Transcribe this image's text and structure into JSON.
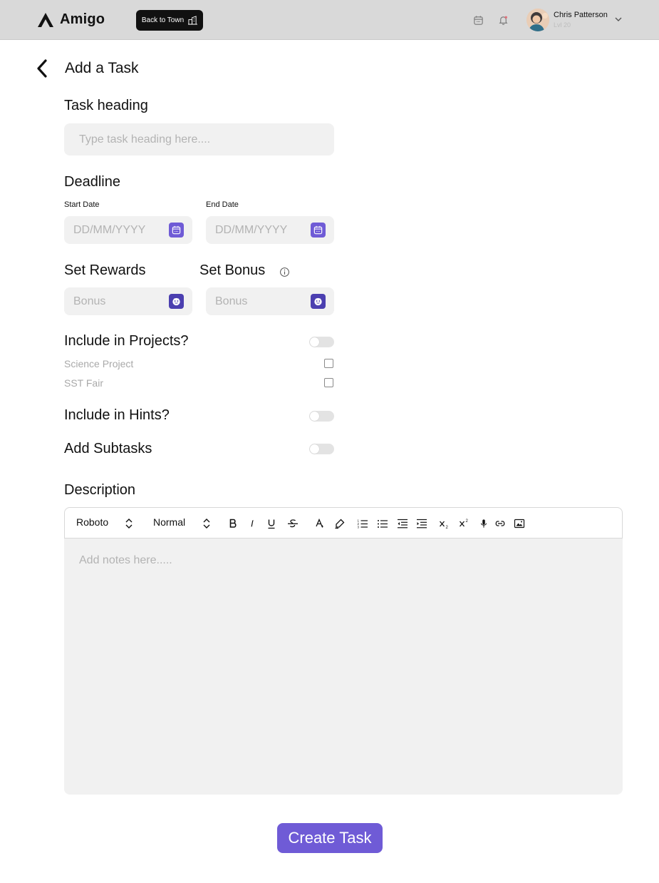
{
  "topbar": {
    "logo_text": "Amigo",
    "back_to_town_label": "Back to Town",
    "user": {
      "name": "Chris Patterson",
      "level": "Lvl 20"
    }
  },
  "page": {
    "title": "Add a Task"
  },
  "task_heading": {
    "title": "Task heading",
    "placeholder": "Type task heading here...."
  },
  "deadline": {
    "title": "Deadline",
    "start_label": "Start Date",
    "start_placeholder": "DD/MM/YYYY",
    "end_label": "End Date",
    "end_placeholder": "DD/MM/YYYY"
  },
  "rewards": {
    "title": "Set Rewards",
    "placeholder": "Bonus"
  },
  "bonus": {
    "title": "Set Bonus",
    "placeholder": "Bonus"
  },
  "projects": {
    "title": "Include in Projects?",
    "enabled": false,
    "items": [
      {
        "label": "Science Project",
        "checked": false
      },
      {
        "label": "SST Fair",
        "checked": false
      }
    ]
  },
  "hints": {
    "title": "Include in Hints?",
    "enabled": false
  },
  "subtasks": {
    "title": "Add Subtasks",
    "enabled": false
  },
  "description": {
    "title": "Description",
    "font_select": "Roboto",
    "style_select": "Normal",
    "placeholder": "Add notes here.....",
    "toolbar_icons": [
      "bold-icon",
      "italic-icon",
      "underline-icon",
      "strikethrough-icon",
      "text-color-icon",
      "highlight-icon",
      "ordered-list-icon",
      "bullet-list-icon",
      "outdent-icon",
      "indent-icon",
      "subscript-icon",
      "superscript-icon",
      "microphone-icon",
      "link-icon",
      "image-icon"
    ]
  },
  "actions": {
    "create_label": "Create Task"
  },
  "colors": {
    "accent": "#6f5bd6",
    "accent_dark": "#4b3fb0",
    "topbar_bg": "#d9d9d9",
    "field_bg": "#f1f1f1"
  }
}
